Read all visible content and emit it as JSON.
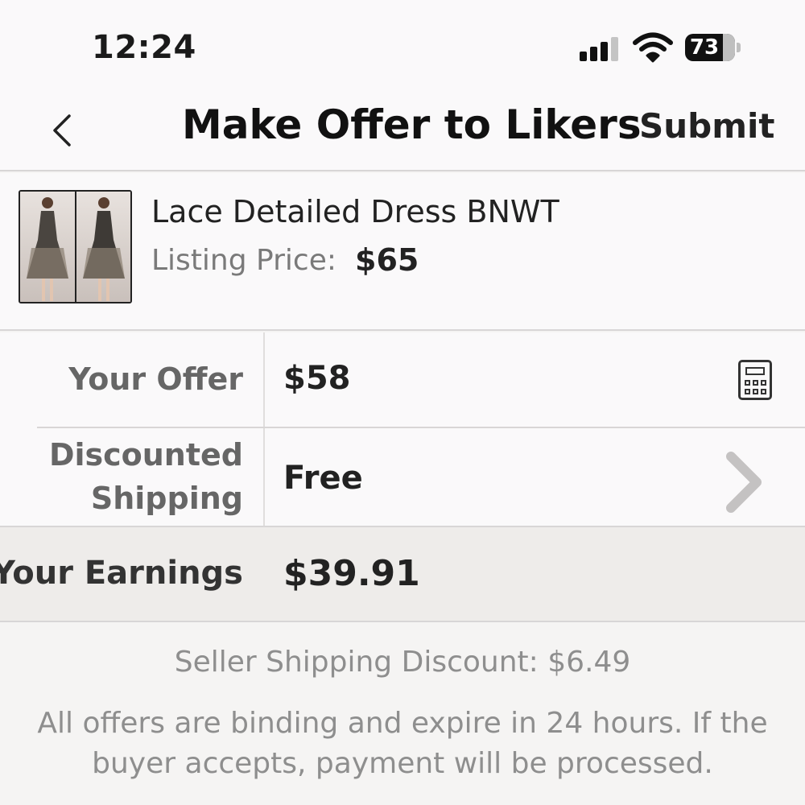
{
  "status_bar": {
    "time": "12:24",
    "battery": "73",
    "icons": [
      "signal-icon",
      "wifi-icon",
      "battery-icon"
    ]
  },
  "nav": {
    "back_icon": "chevron-left-icon",
    "title": "Make Offer to Likers",
    "submit_label": "Submit"
  },
  "listing": {
    "title": "Lace Detailed Dress BNWT",
    "price_label": "Listing Price:",
    "price": "$65"
  },
  "offer": {
    "label": "Your Offer",
    "value": "$58",
    "icon": "calculator-icon"
  },
  "shipping": {
    "label_line1": "Discounted",
    "label_line2": "Shipping",
    "value": "Free",
    "icon": "chevron-right-icon"
  },
  "earnings": {
    "label": "Your Earnings",
    "value": "$39.91"
  },
  "footer": {
    "discount": "Seller Shipping Discount: $6.49",
    "note": "All offers are binding and expire in 24 hours. If the buyer accepts, payment will be processed."
  },
  "colors": {
    "background": "#f5f4f3",
    "panel": "#faf9fa",
    "earnings_bg": "#eeecea",
    "muted_text": "#8e8e8e"
  }
}
